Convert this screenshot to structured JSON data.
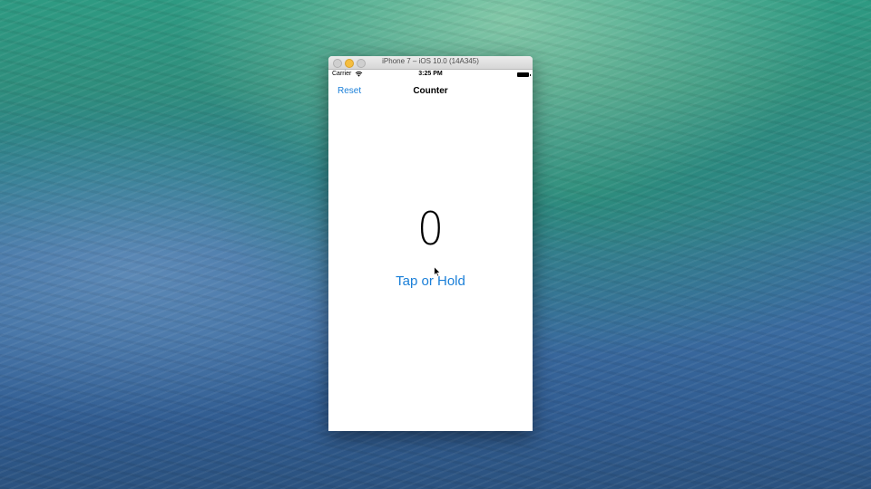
{
  "desktop": {
    "wallpaper": "ocean-wave"
  },
  "simulator": {
    "window_title": "iPhone 7 – iOS 10.0 (14A345)",
    "status_bar": {
      "carrier": "Carrier",
      "time": "3:25 PM",
      "wifi_icon": "wifi-icon",
      "battery_icon": "battery-icon"
    },
    "nav": {
      "reset_label": "Reset",
      "title": "Counter"
    },
    "counter_value": "0",
    "tap_label": "Tap or Hold"
  },
  "colors": {
    "tint": "#1a7fd8",
    "minimize_button": "#f5be3f"
  }
}
